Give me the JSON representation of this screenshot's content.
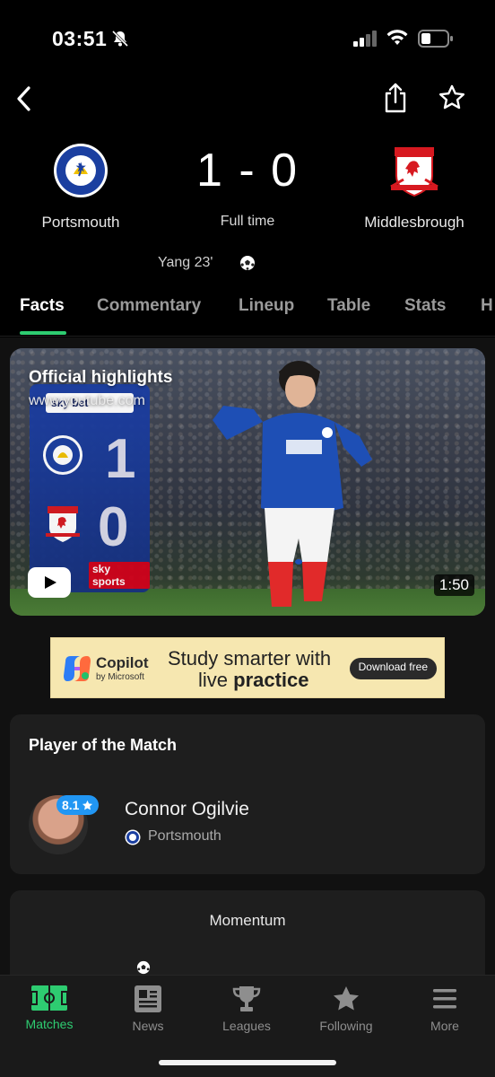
{
  "status_bar": {
    "time": "03:51"
  },
  "match": {
    "home_team": "Portsmouth",
    "away_team": "Middlesbrough",
    "score": "1 - 0",
    "status": "Full time",
    "goal_event": "Yang 23'"
  },
  "tabs": [
    {
      "label": "Facts",
      "active": true
    },
    {
      "label": "Commentary",
      "active": false
    },
    {
      "label": "Lineup",
      "active": false
    },
    {
      "label": "Table",
      "active": false
    },
    {
      "label": "Stats",
      "active": false
    },
    {
      "label": "H",
      "active": false
    }
  ],
  "video": {
    "title": "Official highlights",
    "source": "www.youtube.com",
    "duration": "1:50",
    "scoreboard": {
      "home_goals": "1",
      "away_goals": "0",
      "sponsor": "sky bet",
      "broadcaster": "sky sports"
    }
  },
  "ad": {
    "brand": "Copilot",
    "brand_sub": "by Microsoft",
    "headline_1": "Study smarter with",
    "headline_2_plain": "live ",
    "headline_2_bold": "practice",
    "cta": "Download free"
  },
  "player_of_match": {
    "title": "Player of the Match",
    "rating": "8.1",
    "name": "Connor Ogilvie",
    "team": "Portsmouth"
  },
  "momentum": {
    "title": "Momentum"
  },
  "bottom_nav": [
    {
      "label": "Matches",
      "icon": "pitch-icon",
      "active": true
    },
    {
      "label": "News",
      "icon": "news-icon",
      "active": false
    },
    {
      "label": "Leagues",
      "icon": "trophy-icon",
      "active": false
    },
    {
      "label": "Following",
      "icon": "star-icon",
      "active": false
    },
    {
      "label": "More",
      "icon": "menu-icon",
      "active": false
    }
  ],
  "colors": {
    "accent": "#2ecc71",
    "background": "#000000",
    "card": "#1e1e1e",
    "rating_badge": "#2196f3"
  }
}
